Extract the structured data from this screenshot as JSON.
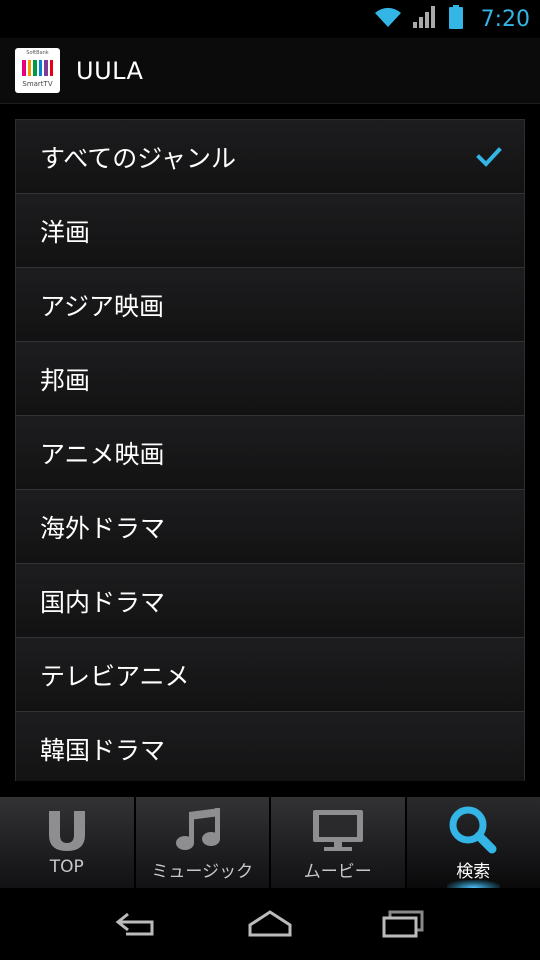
{
  "status_bar": {
    "time": "7:20",
    "icons": [
      "wifi-icon",
      "signal-icon",
      "battery-icon"
    ],
    "accent_color": "#33b5e5"
  },
  "action_bar": {
    "title": "UULA",
    "logo": {
      "top_text": "SoftBank",
      "bottom_text": "SmartTV",
      "bar_colors": [
        "#e4007f",
        "#f39800",
        "#009944",
        "#0086d1",
        "#7d3c98",
        "#e60012"
      ]
    }
  },
  "genre_list": {
    "items": [
      {
        "label": "すべてのジャンル",
        "selected": true
      },
      {
        "label": "洋画",
        "selected": false
      },
      {
        "label": "アジア映画",
        "selected": false
      },
      {
        "label": "邦画",
        "selected": false
      },
      {
        "label": "アニメ映画",
        "selected": false
      },
      {
        "label": "海外ドラマ",
        "selected": false
      },
      {
        "label": "国内ドラマ",
        "selected": false
      },
      {
        "label": "テレビアニメ",
        "selected": false
      },
      {
        "label": "韓国ドラマ",
        "selected": false
      }
    ],
    "check_color": "#33b5e5"
  },
  "tabs": [
    {
      "label": "TOP",
      "icon": "uula-u-icon",
      "active": false
    },
    {
      "label": "ミュージック",
      "icon": "music-note-icon",
      "active": false
    },
    {
      "label": "ムービー",
      "icon": "tv-monitor-icon",
      "active": false
    },
    {
      "label": "検索",
      "icon": "search-icon",
      "active": true
    }
  ],
  "nav_bar": {
    "buttons": [
      "back-icon",
      "home-icon",
      "recent-apps-icon"
    ]
  }
}
